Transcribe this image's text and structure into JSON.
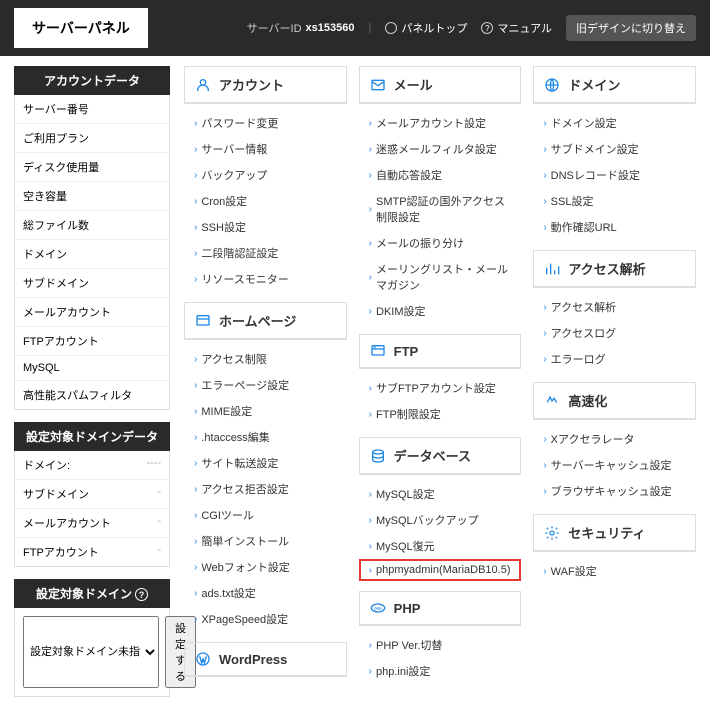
{
  "topbar": {
    "logo": "サーバーパネル",
    "server_label": "サーバーID",
    "server_id": "xs153560",
    "panel_top": "パネルトップ",
    "manual": "マニュアル",
    "old_design": "旧デザインに切り替え"
  },
  "sidebar": {
    "account_data_title": "アカウントデータ",
    "account_rows": [
      {
        "label": "サーバー番号",
        "value": ""
      },
      {
        "label": "ご利用プラン",
        "value": ""
      },
      {
        "label": "ディスク使用量",
        "value": ""
      },
      {
        "label": "空き容量",
        "value": ""
      },
      {
        "label": "総ファイル数",
        "value": ""
      },
      {
        "label": "ドメイン",
        "value": ""
      },
      {
        "label": "サブドメイン",
        "value": ""
      },
      {
        "label": "メールアカウント",
        "value": ""
      },
      {
        "label": "FTPアカウント",
        "value": ""
      },
      {
        "label": "MySQL",
        "value": ""
      },
      {
        "label": "高性能スパムフィルタ",
        "value": ""
      }
    ],
    "domain_data_title": "設定対象ドメインデータ",
    "domain_rows": [
      {
        "label": "ドメイン:",
        "value": "----"
      },
      {
        "label": "サブドメイン",
        "value": "-"
      },
      {
        "label": "メールアカウント",
        "value": "-"
      },
      {
        "label": "FTPアカウント",
        "value": "-"
      }
    ],
    "target_domain_title": "設定対象ドメイン",
    "select_placeholder": "設定対象ドメイン未指",
    "set_button": "設定する"
  },
  "cats": {
    "account": {
      "title": "アカウント",
      "links": [
        "パスワード変更",
        "サーバー情報",
        "バックアップ",
        "Cron設定",
        "SSH設定",
        "二段階認証設定",
        "リソースモニター"
      ]
    },
    "homepage": {
      "title": "ホームページ",
      "links": [
        "アクセス制限",
        "エラーページ設定",
        "MIME設定",
        ".htaccess編集",
        "サイト転送設定",
        "アクセス拒否設定",
        "CGIツール",
        "簡単インストール",
        "Webフォント設定",
        "ads.txt設定",
        "XPageSpeed設定"
      ]
    },
    "wordpress": {
      "title": "WordPress",
      "links": []
    },
    "mail": {
      "title": "メール",
      "links": [
        "メールアカウント設定",
        "迷惑メールフィルタ設定",
        "自動応答設定",
        "SMTP認証の国外アクセス制限設定",
        "メールの振り分け",
        "メーリングリスト・メールマガジン",
        "DKIM設定"
      ]
    },
    "ftp": {
      "title": "FTP",
      "links": [
        "サブFTPアカウント設定",
        "FTP制限設定"
      ]
    },
    "database": {
      "title": "データベース",
      "links": [
        "MySQL設定",
        "MySQLバックアップ",
        "MySQL復元",
        "phpmyadmin(MariaDB10.5)"
      ],
      "highlight_index": 3
    },
    "php": {
      "title": "PHP",
      "links": [
        "PHP Ver.切替",
        "php.ini設定"
      ]
    },
    "domain": {
      "title": "ドメイン",
      "links": [
        "ドメイン設定",
        "サブドメイン設定",
        "DNSレコード設定",
        "SSL設定",
        "動作確認URL"
      ]
    },
    "access": {
      "title": "アクセス解析",
      "links": [
        "アクセス解析",
        "アクセスログ",
        "エラーログ"
      ]
    },
    "speed": {
      "title": "高速化",
      "links": [
        "Xアクセラレータ",
        "サーバーキャッシュ設定",
        "ブラウザキャッシュ設定"
      ]
    },
    "security": {
      "title": "セキュリティ",
      "links": [
        "WAF設定"
      ]
    }
  }
}
